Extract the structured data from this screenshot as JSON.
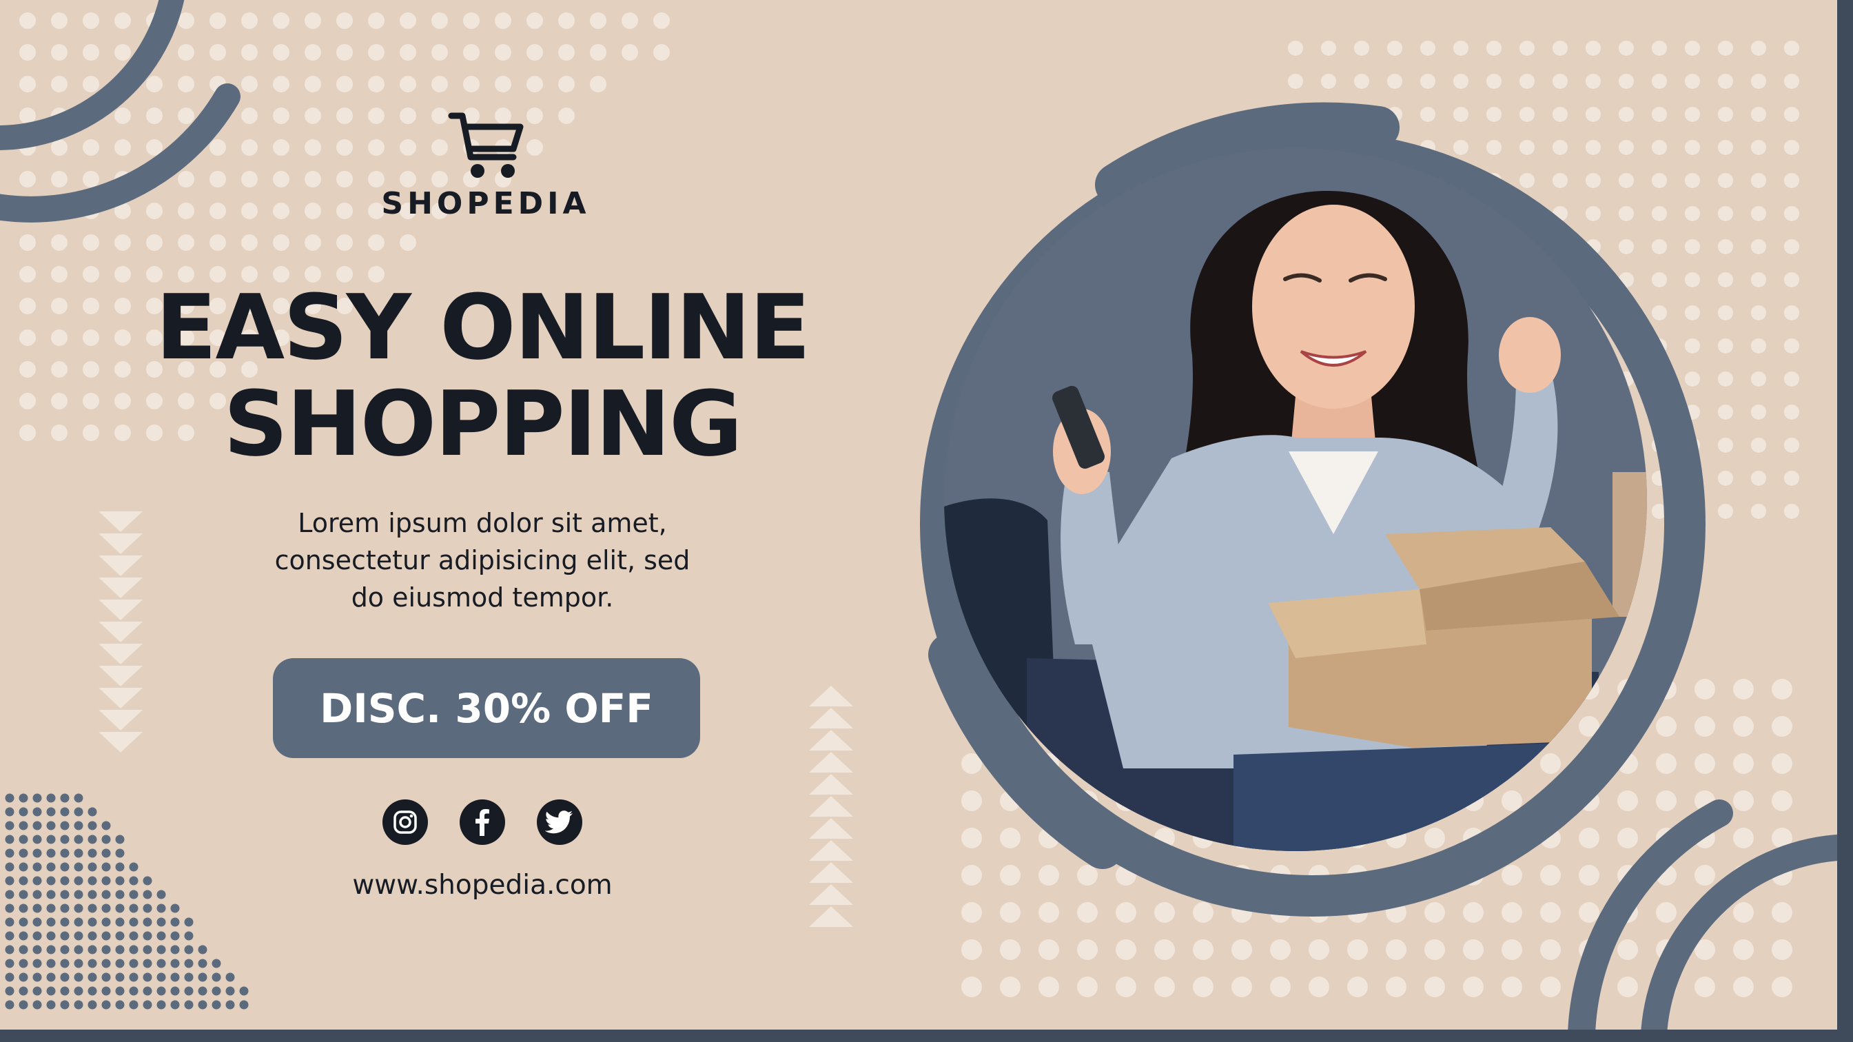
{
  "brand": {
    "name": "SHOPEDIA",
    "logo_icon": "shopping-cart-icon"
  },
  "headline": {
    "line1": "EASY ONLINE",
    "line2": "SHOPPING"
  },
  "description": {
    "line1": "Lorem ipsum dolor sit amet,",
    "line2": "consectetur adipisicing elit, sed",
    "line3": "do eiusmod tempor."
  },
  "cta": {
    "label": "DISC. 30% OFF"
  },
  "social": [
    {
      "name": "instagram",
      "icon": "instagram-icon"
    },
    {
      "name": "facebook",
      "icon": "facebook-icon"
    },
    {
      "name": "twitter",
      "icon": "twitter-icon"
    }
  ],
  "website": "www.shopedia.com",
  "photo": {
    "subject": "woman-celebrating-with-phone-and-open-box"
  },
  "colors": {
    "background": "#e3d0bf",
    "accent": "#5c6a7e",
    "text": "#161b24",
    "dots": "#f1e6dc",
    "frame": "#3f4a5a"
  }
}
